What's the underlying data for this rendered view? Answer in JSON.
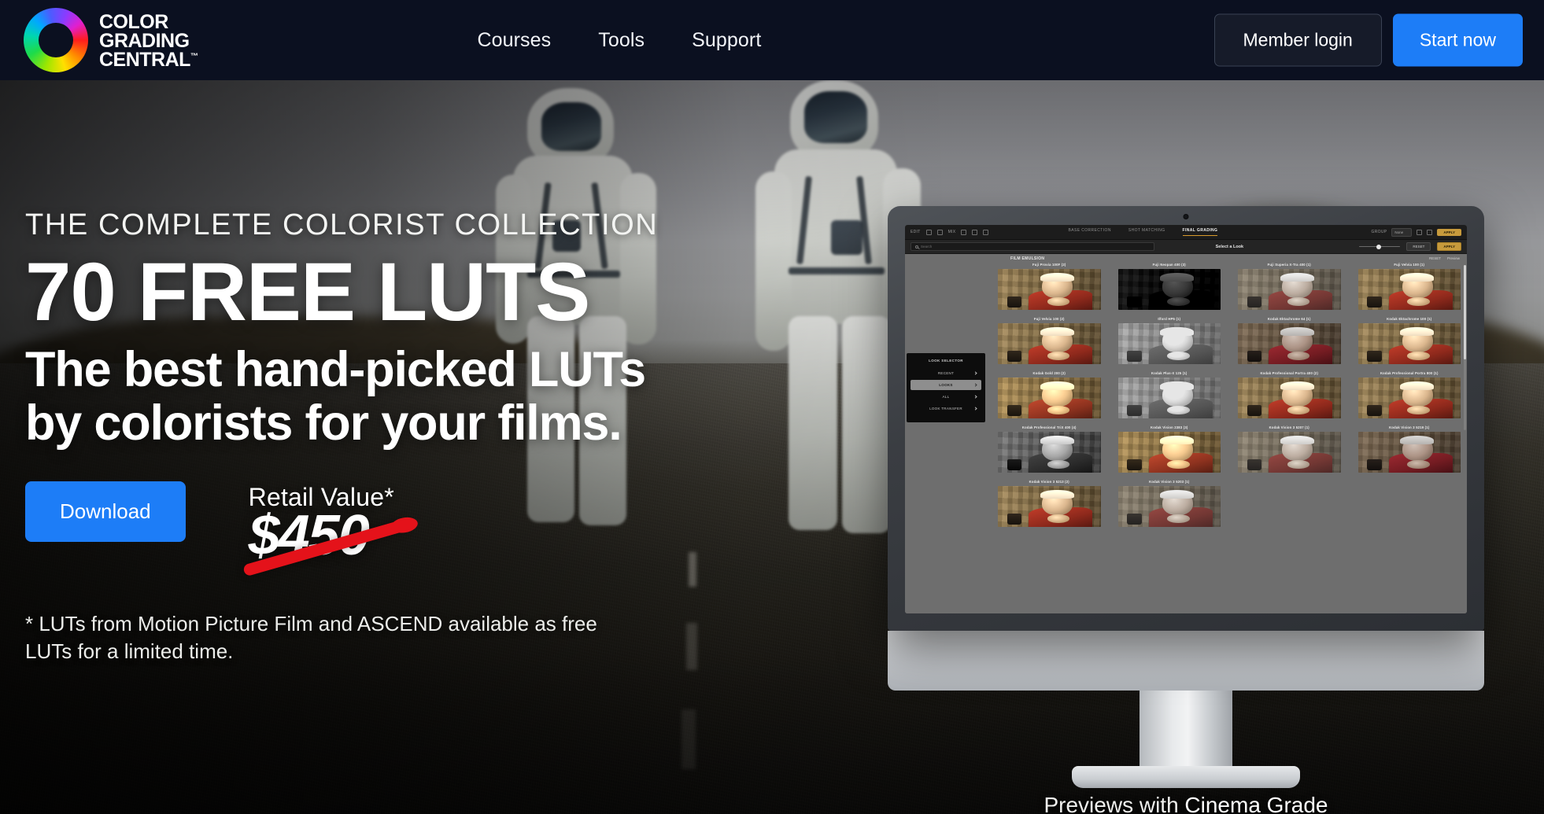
{
  "header": {
    "brand": {
      "logo_icon": "color-wheel-icon",
      "line1": "COLOR",
      "line2": "GRADING",
      "line3": "CENTRAL",
      "trademark": "™"
    },
    "nav": [
      {
        "label": "Courses"
      },
      {
        "label": "Tools"
      },
      {
        "label": "Support"
      }
    ],
    "member_login_label": "Member login",
    "start_now_label": "Start now",
    "background_color": "#0b1020",
    "accent_color": "#1d7df7"
  },
  "hero": {
    "eyebrow": "THE COMPLETE COLORIST COLLECTION",
    "headline": "70 FREE LUTS",
    "subhead": "The best hand-picked LUTs by colorists for your films.",
    "download_label": "Download",
    "retail_label": "Retail Value*",
    "retail_price": "$450",
    "strike_color": "#e4121a",
    "footnote": "* LUTs from Motion Picture Film and ASCEND available as free LUTs for a limited time.",
    "background_scene": "two-astronauts-walking-on-road"
  },
  "monitor": {
    "previews_prefix": "Previews with ",
    "previews_link": "Cinema Grade",
    "app": {
      "toolbar": {
        "left_label": "EDIT",
        "icons": [
          "undo-icon",
          "redo-icon",
          "mask-icon",
          "curve-icon",
          "wheel-icon",
          "grid-icon"
        ],
        "mix_label": "MIX",
        "tabs": [
          {
            "label": "BASE CORRECTION",
            "active": false
          },
          {
            "label": "SHOT MATCHING",
            "active": false
          },
          {
            "label": "FINAL GRADING",
            "active": true
          }
        ],
        "group_label": "GROUP",
        "group_value": "None",
        "right_icons": [
          "search-icon",
          "gear-icon"
        ],
        "apply_label": "APPLY",
        "active_tab_underline_color": "#d79a2b"
      },
      "searchbar": {
        "search_placeholder": "Search",
        "title": "Select a Look",
        "slider_value": 42,
        "reset_label": "RESET",
        "apply_label": "APPLY"
      },
      "sidebar": {
        "title": "LOOK SELECTOR",
        "items": [
          {
            "label": "RECENT",
            "active": false
          },
          {
            "label": "LOOKS",
            "active": true
          },
          {
            "label": "ALL",
            "active": false
          },
          {
            "label": "LOOK TRANSFER",
            "active": false
          }
        ]
      },
      "grid": {
        "group_header": "FILM EMULSION",
        "group_right": [
          "RESET",
          "Preview"
        ],
        "luts": [
          {
            "name": "Fuji Provia 100F (2)",
            "style": "warm"
          },
          {
            "name": "Fuji Neopan 400 (3)",
            "style": "mono-dark"
          },
          {
            "name": "Fuji Superia X-Tra 400 (1)",
            "style": "faded"
          },
          {
            "name": "Fuji Velvia 100 (1)",
            "style": "warm"
          },
          {
            "name": "Fuji Velvia 100 (2)",
            "style": "warm"
          },
          {
            "name": "Ilford HP5 (1)",
            "style": "mono-light"
          },
          {
            "name": "Kodak Ektachrome 64 (1)",
            "style": "cool"
          },
          {
            "name": "Kodak Ektachrome 100 (1)",
            "style": "warm"
          },
          {
            "name": "Kodak Gold 200 (2)",
            "style": "golden"
          },
          {
            "name": "Kodak Plus-X 125 (1)",
            "style": "mono-light"
          },
          {
            "name": "Kodak Professional Portra 400 (2)",
            "style": "warm"
          },
          {
            "name": "Kodak Professional Portra 800 (1)",
            "style": "warm"
          },
          {
            "name": "Kodak Professional TriX 400 (4)",
            "style": "mono"
          },
          {
            "name": "Kodak Vision 2383 (3)",
            "style": "golden"
          },
          {
            "name": "Kodak Vision 3 5207 (1)",
            "style": "faded"
          },
          {
            "name": "Kodak Vision 3 5219 (1)",
            "style": "cool"
          },
          {
            "name": "Kodak Vision 3 5213 (2)",
            "style": "warm"
          },
          {
            "name": "Kodak Vision 3 5203 (1)",
            "style": "faded"
          }
        ]
      }
    }
  }
}
